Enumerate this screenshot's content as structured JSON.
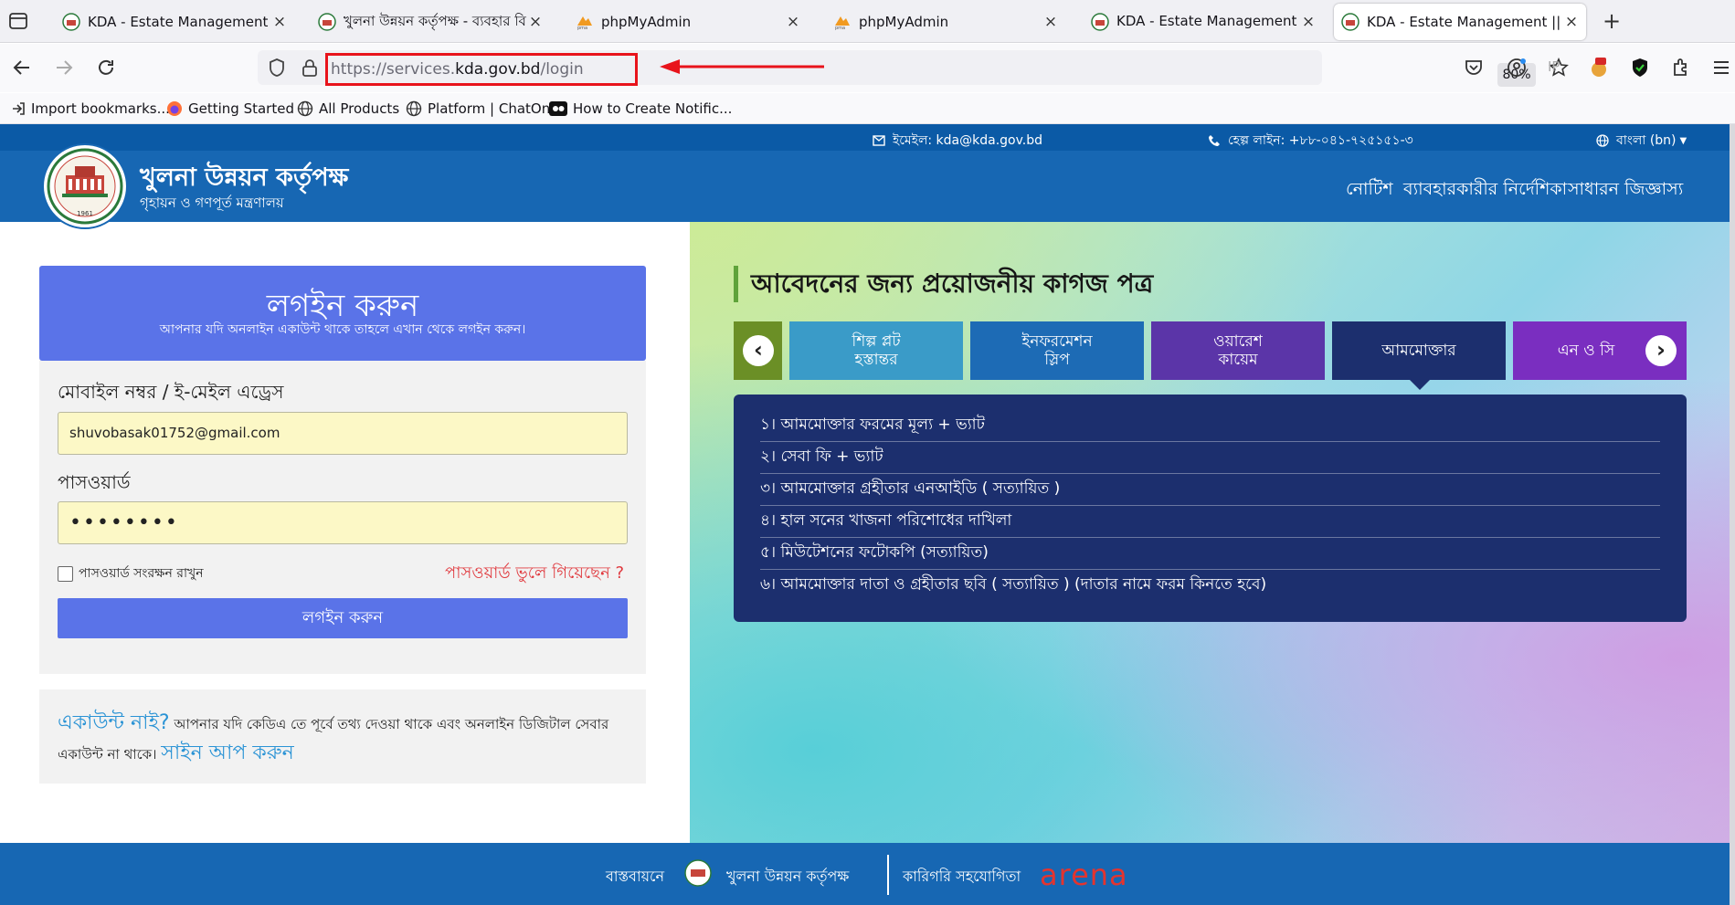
{
  "browser": {
    "tabs": [
      {
        "title": "KDA - Estate Management || Lo",
        "favicon": "kda-logo-icon",
        "active": false
      },
      {
        "title": "খুলনা উন্নয়ন কর্তৃপক্ষ - ব্যবহার বি",
        "favicon": "kda-logo-icon",
        "active": false
      },
      {
        "title": "phpMyAdmin",
        "favicon": "phpmyadmin-icon",
        "active": false
      },
      {
        "title": "phpMyAdmin",
        "favicon": "phpmyadmin-icon",
        "active": false
      },
      {
        "title": "KDA - Estate Management || হ",
        "favicon": "kda-logo-icon",
        "active": false
      },
      {
        "title": "KDA - Estate Management || Lo",
        "favicon": "kda-logo-icon",
        "active": true
      }
    ],
    "url_prefix": "https://services.",
    "url_domain": "kda.gov.bd",
    "url_path": "/login",
    "zoom": "80%",
    "bookmarks": [
      {
        "label": "Import bookmarks...",
        "icon": "import-icon"
      },
      {
        "label": "Getting Started",
        "icon": "firefox-icon"
      },
      {
        "label": "All Products",
        "icon": "globe-icon"
      },
      {
        "label": "Platform | ChatOn",
        "icon": "globe-icon"
      },
      {
        "label": "How to Create Notific...",
        "icon": "video-icon"
      }
    ]
  },
  "page": {
    "topbar": {
      "email": "ইমেইল: kda@kda.gov.bd",
      "hotline": "হেল্প লাইন: +৮৮-০৪১-৭২৫১৫১-৩",
      "language": "বাংলা (bn)"
    },
    "site": {
      "title": "খুলনা উন্নয়ন কর্তৃপক্ষ",
      "subtitle": "গৃহায়ন ও গণপূর্ত মন্ত্রণালয়",
      "logo_year": "1961"
    },
    "nav": [
      "নোটিশ",
      "ব্যাবহারকারীর নির্দেশিকা",
      "সাধারন জিজ্ঞাস্য"
    ],
    "login": {
      "heading": "লগইন করুন",
      "subheading": "আপনার যদি অনলাইন একাউন্ট থাকে তাহলে এখান থেকে লগইন করুন।",
      "mobile_label": "মোবাইল নম্বর / ই-মেইল এড্রেস",
      "mobile_value": "shuvobasak01752@gmail.com",
      "password_label": "পাসওয়ার্ড",
      "password_value": "••••••••",
      "remember_label": "পাসওয়ার্ড সংরক্ষন রাখুন",
      "forgot_label": "পাসওয়ার্ড ভুলে গিয়েছেন ?",
      "button_label": "লগইন করুন"
    },
    "signup": {
      "no_account": "একাউন্ট নাই?",
      "text1": " আপনার যদি কেডিএ তে পূর্বে তথ্য দেওয়া থাকে এবং অনলাইন ডিজিটাল সেবার",
      "text2": "একাউন্ট না থাকে। ",
      "link": "সাইন আপ করুন"
    },
    "docs": {
      "title": "আবেদনের জন্য প্রয়োজনীয় কাগজ পত্র",
      "cards": [
        {
          "label": "শিল্প প্লট\nহস্তান্তর",
          "color": "#3a9bc8"
        },
        {
          "label": "ইনফরমেশন\nস্লিপ",
          "color": "#1d6bb5"
        },
        {
          "label": "ওয়ারেশ\nকায়েম",
          "color": "#5b35a8"
        },
        {
          "label": "আমমোক্তার",
          "color": "#1c2f6e"
        },
        {
          "label": "এন ও সি",
          "color": "#7a2ec0"
        }
      ],
      "items": [
        "১। আমমোক্তার ফরমের মূল্য + ভ্যাট",
        "২। সেবা ফি + ভ্যাট",
        "৩। আমমোক্তার গ্রহীতার এনআইডি ( সত্যায়িত )",
        "৪। হাল সনের খাজনা পরিশোধের দাখিলা",
        "৫। মিউটেশনের ফটোকপি (সত্যায়িত)",
        "৬। আমমোক্তার দাতা ও গ্রহীতার ছবি ( সত্যায়িত )  (দাতার নামে ফরম কিনতে হবে)"
      ]
    },
    "footer": {
      "implemented_by": "বাস্তবায়নে",
      "org": "খুলনা উন্নয়ন কর্তৃপক্ষ",
      "tech_support": "কারিগরি সহযোগিতা",
      "partner": "arena"
    }
  }
}
